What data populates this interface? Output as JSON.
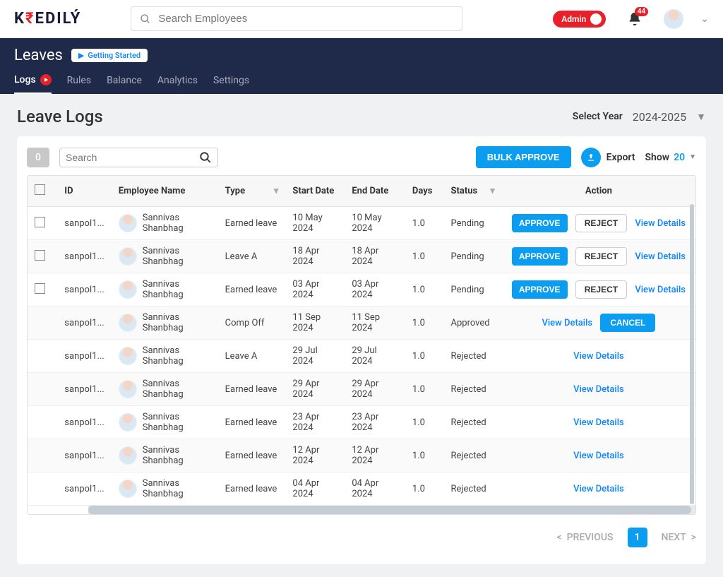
{
  "brand": "KREDILY",
  "global_search_placeholder": "Search Employees",
  "admin_label": "Admin",
  "notification_count": "44",
  "nav": {
    "title": "Leaves",
    "getting_started": "Getting Started",
    "tabs": [
      "Logs",
      "Rules",
      "Balance",
      "Analytics",
      "Settings"
    ]
  },
  "page": {
    "title": "Leave Logs",
    "select_year_label": "Select Year",
    "select_year_value": "2024-2025"
  },
  "toolbar": {
    "selected_count": "0",
    "search_placeholder": "Search",
    "bulk_approve": "BULK APPROVE",
    "export": "Export",
    "show_label": "Show",
    "show_value": "20"
  },
  "columns": {
    "id": "ID",
    "employee": "Employee Name",
    "type": "Type",
    "start": "Start Date",
    "end": "End Date",
    "days": "Days",
    "status": "Status",
    "action": "Action"
  },
  "actions": {
    "approve": "APPROVE",
    "reject": "REJECT",
    "view_details": "View Details",
    "cancel": "CANCEL"
  },
  "rows": [
    {
      "id": "sanpol1...",
      "employee": "Sannivas Shanbhag",
      "type": "Earned leave",
      "start": "10 May 2024",
      "end": "10 May 2024",
      "days": "1.0",
      "status": "Pending"
    },
    {
      "id": "sanpol1...",
      "employee": "Sannivas Shanbhag",
      "type": "Leave A",
      "start": "18 Apr 2024",
      "end": "18 Apr 2024",
      "days": "1.0",
      "status": "Pending"
    },
    {
      "id": "sanpol1...",
      "employee": "Sannivas Shanbhag",
      "type": "Earned leave",
      "start": "03 Apr 2024",
      "end": "03 Apr 2024",
      "days": "1.0",
      "status": "Pending"
    },
    {
      "id": "sanpol1...",
      "employee": "Sannivas Shanbhag",
      "type": "Comp Off",
      "start": "11 Sep 2024",
      "end": "11 Sep 2024",
      "days": "1.0",
      "status": "Approved"
    },
    {
      "id": "sanpol1...",
      "employee": "Sannivas Shanbhag",
      "type": "Leave A",
      "start": "29 Jul 2024",
      "end": "29 Jul 2024",
      "days": "1.0",
      "status": "Rejected"
    },
    {
      "id": "sanpol1...",
      "employee": "Sannivas Shanbhag",
      "type": "Earned leave",
      "start": "29 Apr 2024",
      "end": "29 Apr 2024",
      "days": "1.0",
      "status": "Rejected"
    },
    {
      "id": "sanpol1...",
      "employee": "Sannivas Shanbhag",
      "type": "Earned leave",
      "start": "23 Apr 2024",
      "end": "23 Apr 2024",
      "days": "1.0",
      "status": "Rejected"
    },
    {
      "id": "sanpol1...",
      "employee": "Sannivas Shanbhag",
      "type": "Earned leave",
      "start": "12 Apr 2024",
      "end": "12 Apr 2024",
      "days": "1.0",
      "status": "Rejected"
    },
    {
      "id": "sanpol1...",
      "employee": "Sannivas Shanbhag",
      "type": "Earned leave",
      "start": "04 Apr 2024",
      "end": "04 Apr 2024",
      "days": "1.0",
      "status": "Rejected"
    }
  ],
  "pagination": {
    "previous": "PREVIOUS",
    "current": "1",
    "next": "NEXT"
  }
}
